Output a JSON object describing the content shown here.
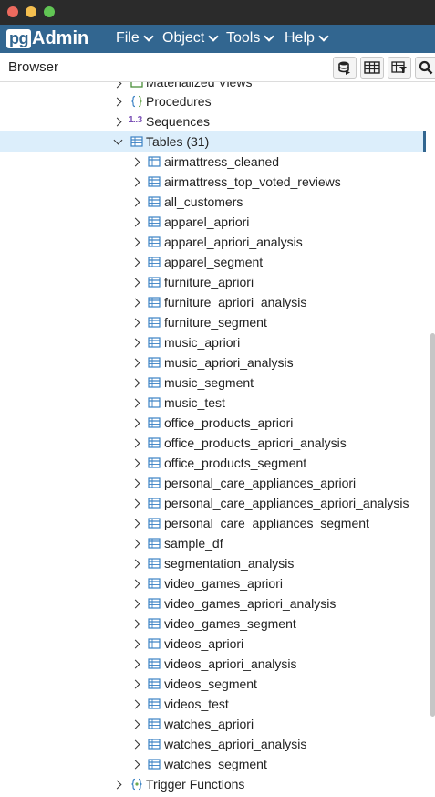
{
  "app": {
    "logo_pg": "pg",
    "logo_admin": "Admin"
  },
  "menus": [
    {
      "label": "File"
    },
    {
      "label": "Object"
    },
    {
      "label": "Tools"
    },
    {
      "label": "Help"
    }
  ],
  "browser": {
    "title": "Browser"
  },
  "toolbar_icons": [
    "query-tool-icon",
    "view-data-icon",
    "filtered-rows-icon",
    "search-icon"
  ],
  "tree": {
    "partial_top": {
      "label": "Materialized Views",
      "icon": "materialized-views-icon"
    },
    "procedures": {
      "label": "Procedures",
      "icon": "procedures-icon"
    },
    "sequences": {
      "label": "Sequences",
      "icon_text": "1..3",
      "icon": "sequences-icon"
    },
    "tables": {
      "label": "Tables (31)",
      "icon": "tables-icon"
    },
    "table_items": [
      "airmattress_cleaned",
      "airmattress_top_voted_reviews",
      "all_customers",
      "apparel_apriori",
      "apparel_apriori_analysis",
      "apparel_segment",
      "furniture_apriori",
      "furniture_apriori_analysis",
      "furniture_segment",
      "music_apriori",
      "music_apriori_analysis",
      "music_segment",
      "music_test",
      "office_products_apriori",
      "office_products_apriori_analysis",
      "office_products_segment",
      "personal_care_appliances_apriori",
      "personal_care_appliances_apriori_analysis",
      "personal_care_appliances_segment",
      "sample_df",
      "segmentation_analysis",
      "video_games_apriori",
      "video_games_apriori_analysis",
      "video_games_segment",
      "videos_apriori",
      "videos_apriori_analysis",
      "videos_segment",
      "videos_test",
      "watches_apriori",
      "watches_apriori_analysis",
      "watches_segment"
    ],
    "trigger_functions": {
      "label": "Trigger Functions",
      "icon": "trigger-functions-icon"
    }
  },
  "colors": {
    "menubar": "#326690",
    "selected_row": "#dceefb",
    "table_icon": "#3b82c4"
  }
}
